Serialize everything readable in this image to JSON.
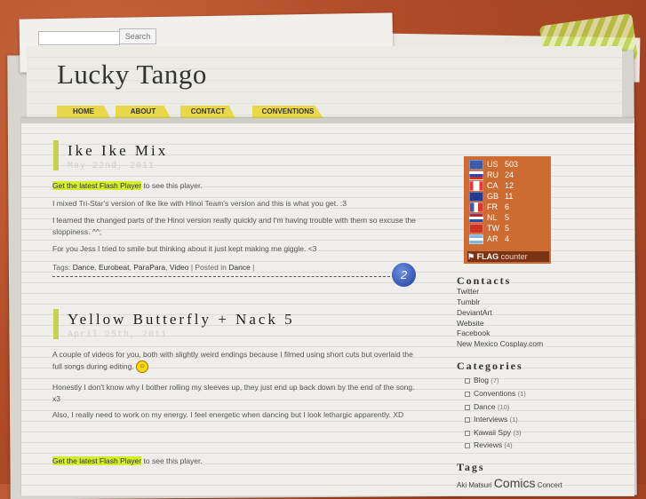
{
  "search": {
    "placeholder": "",
    "button_label": "Search"
  },
  "site_title": "Lucky Tango",
  "nav": [
    {
      "label": "HOME"
    },
    {
      "label": "ABOUT"
    },
    {
      "label": "CONTACT"
    },
    {
      "label": "CONVENTIONS"
    }
  ],
  "posts": [
    {
      "title": "Ike Ike Mix",
      "date": "May 22nd, 2011",
      "flash_link": "Get the latest Flash Player",
      "flash_suffix": " to see this player.",
      "p1": "I mixed Tri-Star's version of Ike Ike with Hinoi Team's version and this is what you get. :3",
      "p2": "I learned the changed parts of the Hinoi version really quickly and I'm having trouble with them so excuse the sloppiness. ^^;",
      "p3": "For you Jess I tried to smile but thinking about it just kept making me giggle. <3",
      "tags_label": "Tags: ",
      "tags": [
        "Dance",
        "Eurobeat",
        "ParaPara",
        "Video"
      ],
      "posted_in_label": " | Posted in ",
      "category": "Dance",
      "comments": "2"
    },
    {
      "title": "Yellow Butterfly + Nack 5",
      "date": "April 25th, 2011",
      "p1": "A couple of videos for you, both with slightly weird endings because I filmed using short cuts but overlaid the full songs during editing.",
      "p2": "Honestly I don't know why I bother rolling my sleeves up, they just end up back down by the end of the song. x3",
      "p3": "Also, I really need to work on my energy. I feel energetic when dancing but I look lethargic apparently. XD",
      "flash_link": "Get the latest Flash Player",
      "flash_suffix": " to see this player."
    }
  ],
  "flag_counter": {
    "rows": [
      {
        "code": "US",
        "count": "503",
        "color": "#3c5aa6"
      },
      {
        "code": "RU",
        "count": "24",
        "color": "#d52b1e"
      },
      {
        "code": "CA",
        "count": "12",
        "color": "#e33"
      },
      {
        "code": "GB",
        "count": "11",
        "color": "#243a8c"
      },
      {
        "code": "FR",
        "count": "6",
        "color": "#3b5bb0"
      },
      {
        "code": "NL",
        "count": "5",
        "color": "#c4282f"
      },
      {
        "code": "TW",
        "count": "5",
        "color": "#c32"
      },
      {
        "code": "AR",
        "count": "4",
        "color": "#7fb7e0"
      }
    ],
    "footer_flag": "FLAG",
    "footer_counter": "counter"
  },
  "contacts": {
    "heading": "Contacts",
    "links": [
      "Twitter",
      "Tumblr",
      "DeviantArt",
      "Website",
      "Facebook",
      "New Mexico Cosplay.com"
    ]
  },
  "categories": {
    "heading": "Categories",
    "items": [
      {
        "label": "Blog",
        "count": "(7)"
      },
      {
        "label": "Conventions",
        "count": "(1)"
      },
      {
        "label": "Dance",
        "count": "(10)"
      },
      {
        "label": "Interviews",
        "count": "(1)"
      },
      {
        "label": "Kawaii Spy",
        "count": "(3)"
      },
      {
        "label": "Reviews",
        "count": "(4)"
      }
    ]
  },
  "tags_section": {
    "heading": "Tags",
    "cloud_a": "Aki Matsuri ",
    "cloud_b": "Comics",
    "cloud_c": " Concert"
  }
}
